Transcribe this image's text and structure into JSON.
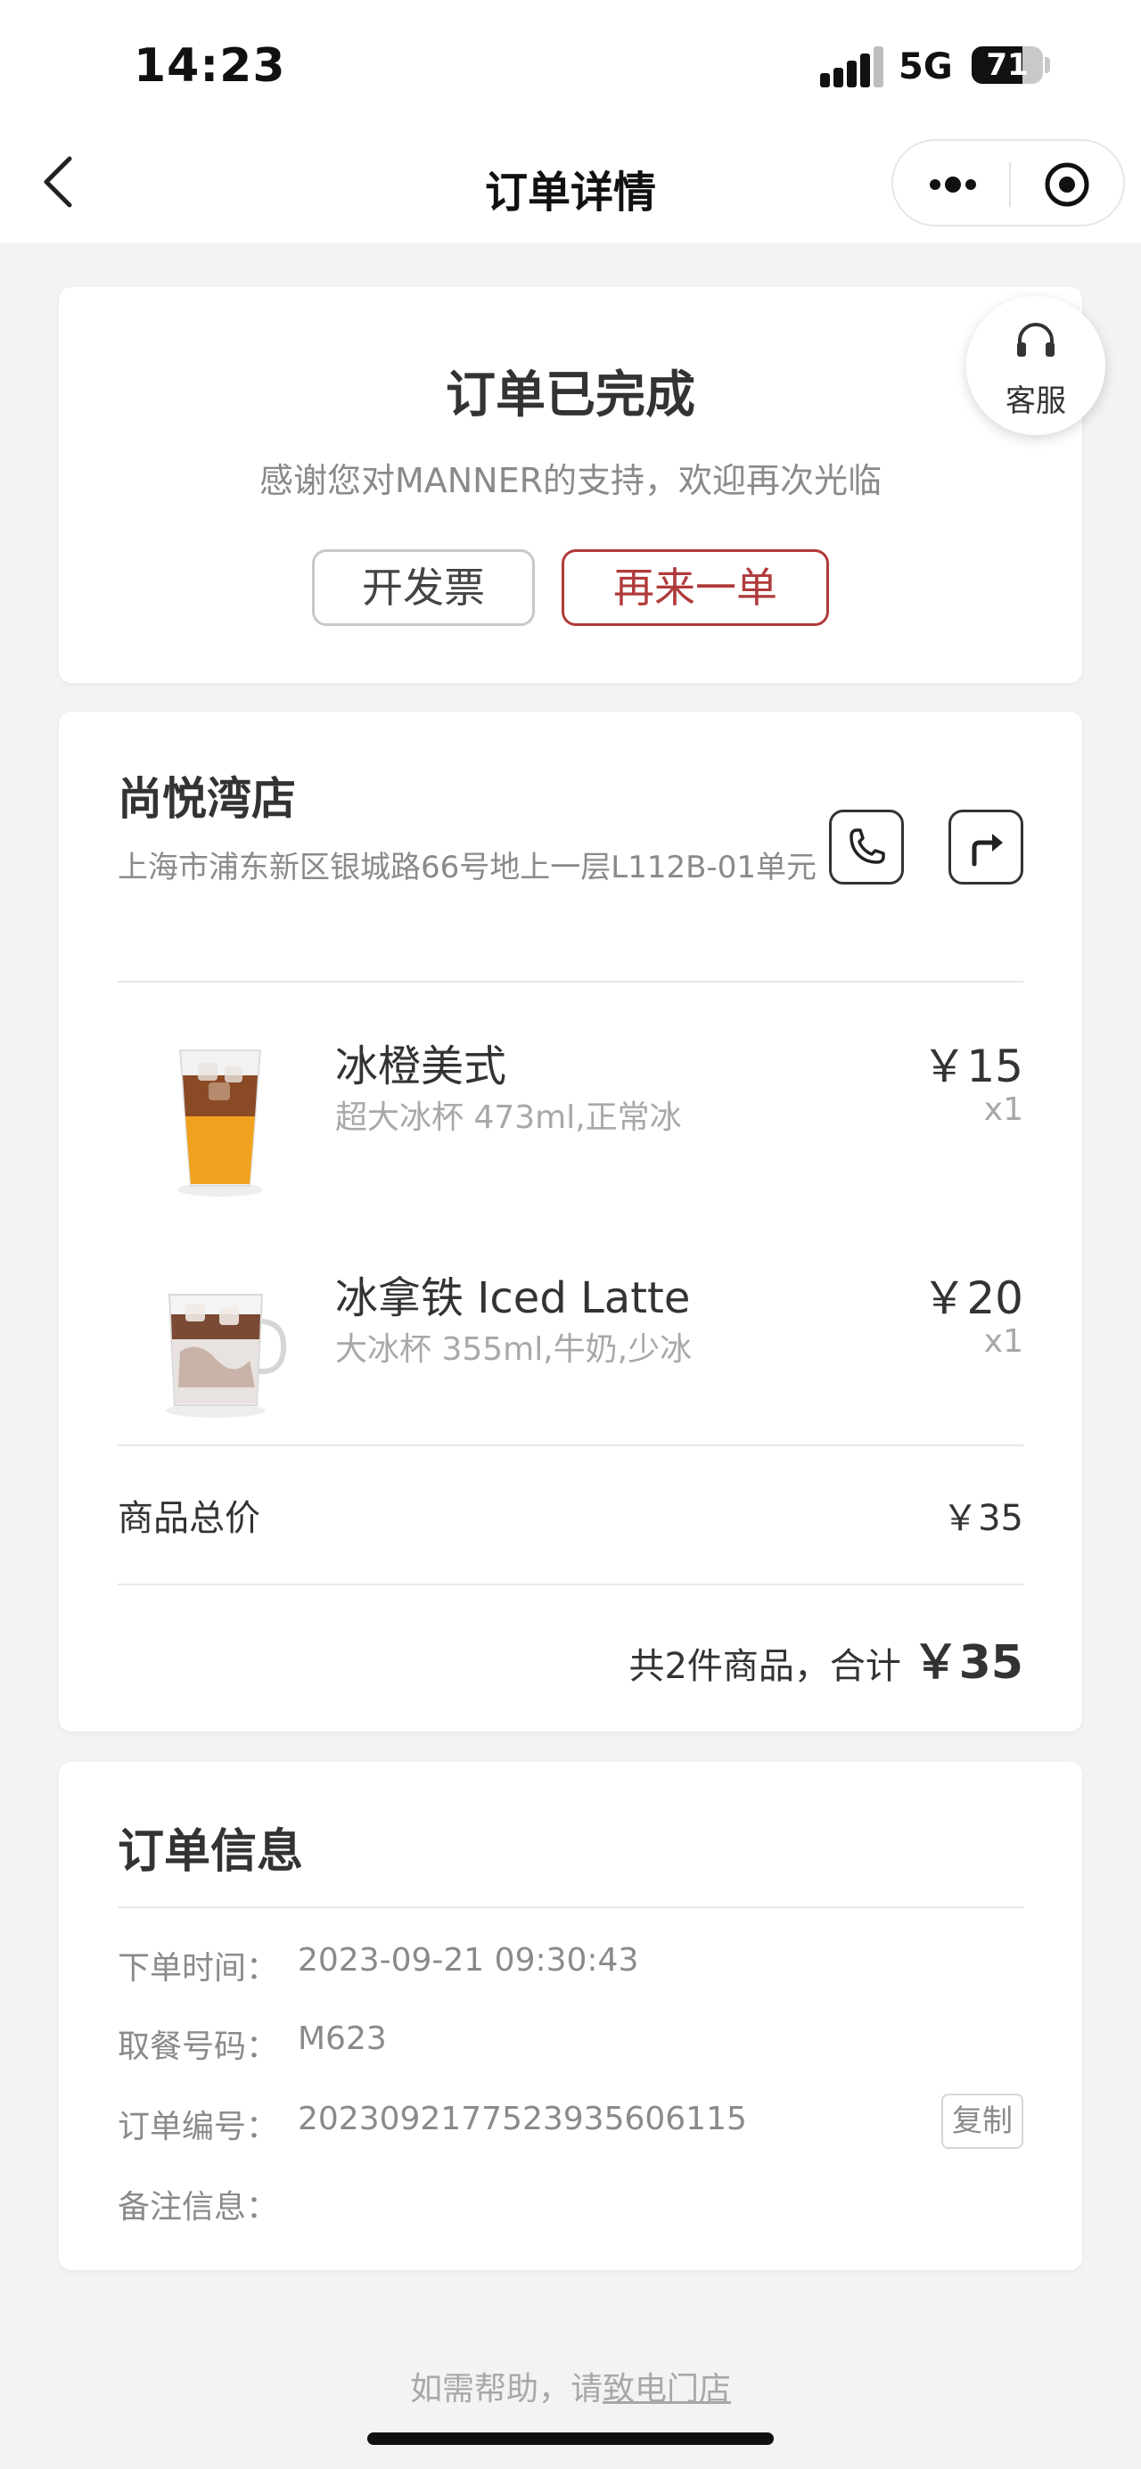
{
  "status_bar": {
    "time": "14:23",
    "network": "5G",
    "battery": "71",
    "battery_level": 0.71
  },
  "nav": {
    "title": "订单详情",
    "back_icon": "chevron-left-icon",
    "more_icon": "more-dots-icon",
    "close_icon": "target-circle-icon"
  },
  "order_status": {
    "title": "订单已完成",
    "subtitle": "感谢您对MANNER的支持，欢迎再次光临",
    "invoice_label": "开发票",
    "reorder_label": "再来一单",
    "accent_color": "#b03a3a"
  },
  "customer_service": {
    "label": "客服",
    "icon": "headset-icon"
  },
  "store": {
    "name": "尚悦湾店",
    "address": "上海市浦东新区银城路66号地上一层L112B-01单元",
    "phone_icon": "phone-icon",
    "nav_icon": "directions-icon"
  },
  "items": [
    {
      "name": "冰橙美式",
      "spec": "超大冰杯 473ml,正常冰",
      "price": "￥15",
      "qty": "x1",
      "image": "iced-orange-americano-image"
    },
    {
      "name": "冰拿铁 Iced Latte",
      "spec": "大冰杯 355ml,牛奶,少冰",
      "price": "￥20",
      "qty": "x1",
      "image": "iced-latte-image"
    }
  ],
  "summary": {
    "subtotal_label": "商品总价",
    "subtotal_value": "￥35",
    "total_prefix": "共2件商品，合计",
    "total_amount": "￥35"
  },
  "order_info": {
    "title": "订单信息",
    "rows": [
      {
        "label": "下单时间：",
        "value": "2023-09-21 09:30:43"
      },
      {
        "label": "取餐号码：",
        "value": "M623"
      },
      {
        "label": "订单编号：",
        "value": "20230921775239356061​15"
      },
      {
        "label": "备注信息：",
        "value": ""
      }
    ],
    "copy_label": "复制"
  },
  "footer": {
    "help_prefix": "如需帮助，请",
    "help_link": "致电门店"
  }
}
